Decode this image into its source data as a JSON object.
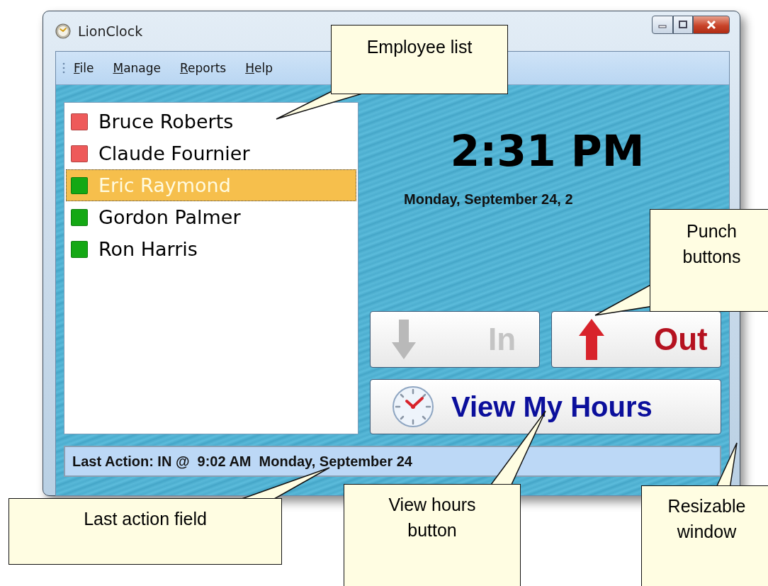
{
  "window": {
    "title": "LionClock"
  },
  "menu": [
    {
      "label": "File"
    },
    {
      "label": "Manage"
    },
    {
      "label": "Reports"
    },
    {
      "label": "Help"
    }
  ],
  "employees": [
    {
      "name": "Bruce Roberts",
      "color": "#ee5a5a",
      "selected": false
    },
    {
      "name": "Claude Fournier",
      "color": "#ee5a5a",
      "selected": false
    },
    {
      "name": "Eric Raymond",
      "color": "#14a814",
      "selected": true
    },
    {
      "name": "Gordon Palmer",
      "color": "#14a814",
      "selected": false
    },
    {
      "name": "Ron Harris",
      "color": "#14a814",
      "selected": false
    }
  ],
  "clock": {
    "time": "2:31 PM",
    "date": "Monday, September 24, 2"
  },
  "punch_buttons": [
    {
      "label": "In",
      "kind": "in",
      "disabled": true
    },
    {
      "label": "Out",
      "kind": "out",
      "disabled": false
    }
  ],
  "view_hours_button": {
    "label": "View My Hours"
  },
  "last_action": "Last Action: IN @  9:02 AM  Monday, September 24",
  "callouts": [
    {
      "text": "Employee list"
    },
    {
      "text": "Punch buttons"
    },
    {
      "text": "Last action field"
    },
    {
      "text": "View hours button"
    },
    {
      "text": "Resizable window"
    }
  ]
}
